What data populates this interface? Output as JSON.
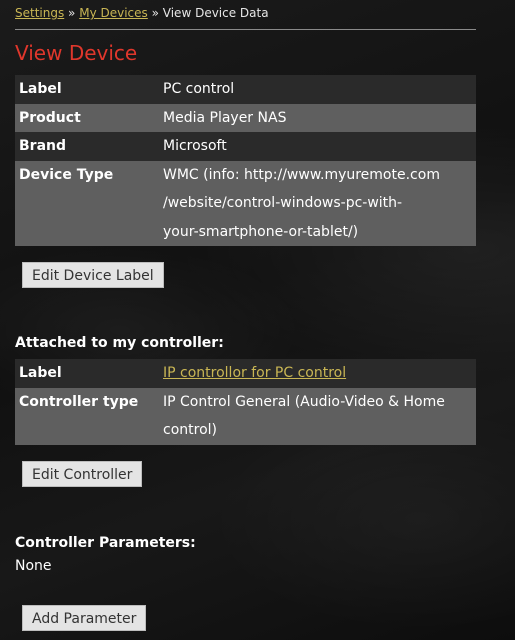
{
  "breadcrumb": {
    "items": [
      "Settings",
      "My Devices"
    ],
    "separator": "»",
    "current": "View Device Data"
  },
  "page": {
    "title": "View Device"
  },
  "device": {
    "rows": [
      {
        "label": "Label",
        "value": "PC control"
      },
      {
        "label": "Product",
        "value": "Media Player NAS"
      },
      {
        "label": "Brand",
        "value": "Microsoft"
      },
      {
        "label": "Device Type",
        "value_lines": [
          "WMC (info: http://www.myuremote.com",
          "/website/control-windows-pc-with-",
          "your-smartphone-or-tablet/)"
        ]
      }
    ],
    "edit_button": "Edit Device Label"
  },
  "controller": {
    "heading": "Attached to my controller:",
    "rows": [
      {
        "label": "Label",
        "value": "IP controllor for PC control"
      },
      {
        "label": "Controller type",
        "value_lines": [
          "IP Control General (Audio-Video & Home",
          "control)"
        ]
      }
    ],
    "edit_button": "Edit Controller"
  },
  "parameters": {
    "heading": "Controller Parameters:",
    "value": "None",
    "add_button": "Add Parameter"
  },
  "colors": {
    "accent_title": "#e0372c",
    "link": "#c9b654",
    "row_dark": "#2a2a2a",
    "row_gray": "#5f5f5f"
  }
}
